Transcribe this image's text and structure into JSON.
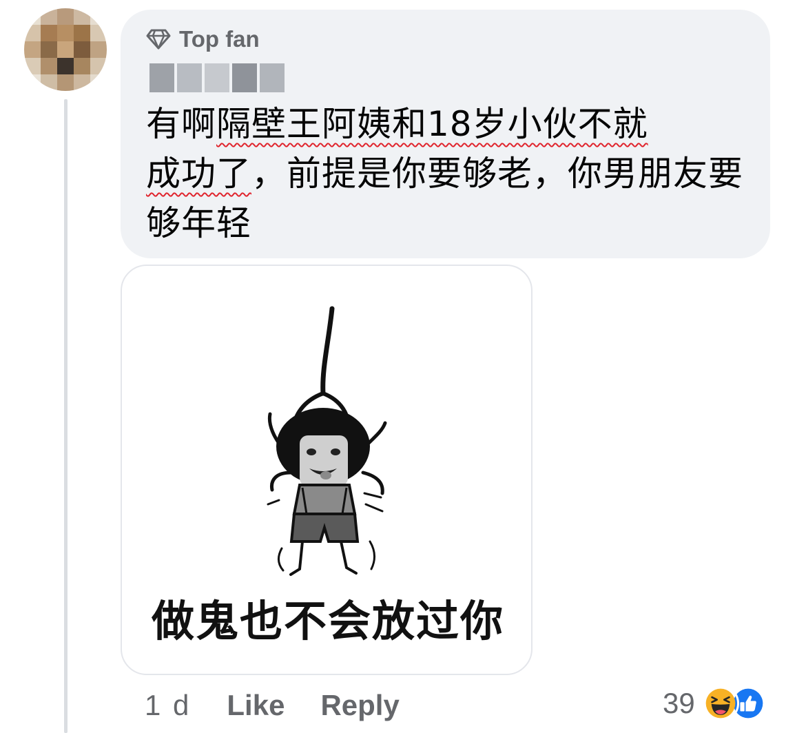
{
  "comment": {
    "badge": "Top fan",
    "author": "",
    "text_parts": {
      "a": "有啊",
      "b": "隔壁王阿姨和18岁小伙不就",
      "c": "成功了",
      "d": "，前提是你要够老，你男朋友要够年轻"
    },
    "sticker": {
      "caption": "做鬼也不会放过你"
    },
    "time": "1 d",
    "like_label": "Like",
    "reply_label": "Reply",
    "reaction_count": "39",
    "reaction_icons": [
      "haha-icon",
      "like-icon"
    ]
  },
  "colors": {
    "bubble": "#f0f2f5",
    "secondary_text": "#65676b",
    "primary_text": "#050505",
    "spellcheck_underline": "#e0242d",
    "like_blue": "#1877f2",
    "haha_yellow": "#f7b125"
  }
}
